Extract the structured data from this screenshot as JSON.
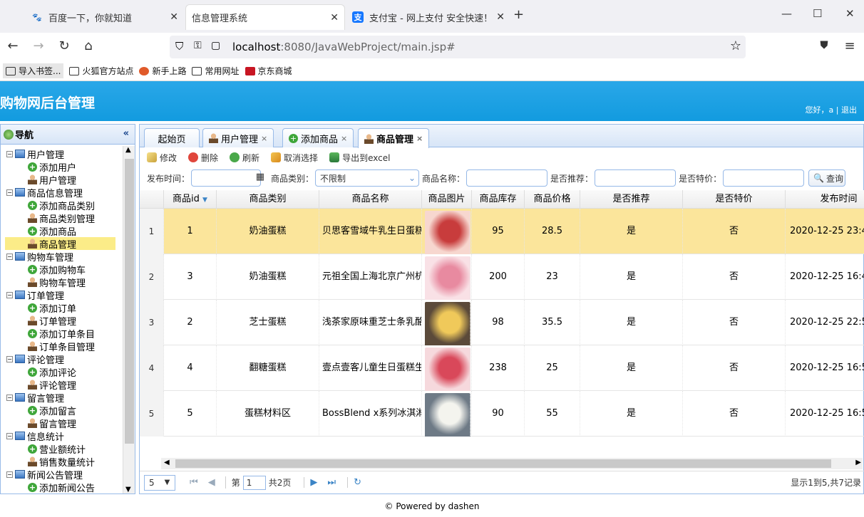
{
  "browser": {
    "tabs": [
      {
        "label": "百度一下，你就知道"
      },
      {
        "label": "信息管理系统"
      },
      {
        "label": "支付宝 - 网上支付 安全快速！"
      }
    ],
    "url_host": "localhost",
    "url_rest": ":8080/JavaWebProject/main.jsp#",
    "bookmarks": [
      "导入书签...",
      "火狐官方站点",
      "新手上路",
      "常用网址",
      "京东商城"
    ]
  },
  "header": {
    "title": "购物网后台管理",
    "greeting": "您好，a",
    "separator": "|",
    "logout": "退出"
  },
  "sidebar": {
    "title": "导航",
    "collapse": "«",
    "items": [
      {
        "label": "用户管理",
        "type": "group"
      },
      {
        "label": "添加用户",
        "type": "add"
      },
      {
        "label": "用户管理",
        "type": "manage"
      },
      {
        "label": "商品信息管理",
        "type": "group"
      },
      {
        "label": "添加商品类别",
        "type": "add"
      },
      {
        "label": "商品类别管理",
        "type": "manage"
      },
      {
        "label": "添加商品",
        "type": "add"
      },
      {
        "label": "商品管理",
        "type": "manage"
      },
      {
        "label": "购物车管理",
        "type": "group"
      },
      {
        "label": "添加购物车",
        "type": "add"
      },
      {
        "label": "购物车管理",
        "type": "manage"
      },
      {
        "label": "订单管理",
        "type": "group"
      },
      {
        "label": "添加订单",
        "type": "add"
      },
      {
        "label": "订单管理",
        "type": "manage"
      },
      {
        "label": "添加订单条目",
        "type": "add"
      },
      {
        "label": "订单条目管理",
        "type": "manage"
      },
      {
        "label": "评论管理",
        "type": "group"
      },
      {
        "label": "添加评论",
        "type": "add"
      },
      {
        "label": "评论管理",
        "type": "manage"
      },
      {
        "label": "留言管理",
        "type": "group"
      },
      {
        "label": "添加留言",
        "type": "add"
      },
      {
        "label": "留言管理",
        "type": "manage"
      },
      {
        "label": "信息统计",
        "type": "group"
      },
      {
        "label": "营业额统计",
        "type": "add"
      },
      {
        "label": "销售数量统计",
        "type": "manage"
      },
      {
        "label": "新闻公告管理",
        "type": "group"
      },
      {
        "label": "添加新闻公告",
        "type": "add"
      }
    ]
  },
  "main_tabs": [
    {
      "label": "起始页"
    },
    {
      "label": "用户管理"
    },
    {
      "label": "添加商品"
    },
    {
      "label": "商品管理"
    }
  ],
  "toolbar": {
    "edit": "修改",
    "delete": "删除",
    "refresh": "刷新",
    "cancel_select": "取消选择",
    "export": "导出到excel"
  },
  "filter": {
    "publish_time_label": "发布时间：",
    "category_label": "商品类别：",
    "category_value": "不限制",
    "name_label": "商品名称：",
    "recommend_label": "是否推荐：",
    "special_label": "是否特价：",
    "query": "查询"
  },
  "table": {
    "columns": [
      "商品id",
      "商品类别",
      "商品名称",
      "商品图片",
      "商品库存",
      "商品价格",
      "是否推荐",
      "是否特价",
      "发布时间"
    ],
    "rows": [
      {
        "rn": "1",
        "id": "1",
        "category": "奶油蛋糕",
        "name": "贝思客雪域牛乳生日蛋糕",
        "stock": "95",
        "price": "28.5",
        "recommend": "是",
        "special": "否",
        "time": "2020-12-25 23:4"
      },
      {
        "rn": "2",
        "id": "3",
        "category": "奶油蛋糕",
        "name": "元祖全国上海北京广州杭",
        "stock": "200",
        "price": "23",
        "recommend": "是",
        "special": "否",
        "time": "2020-12-25 16:4"
      },
      {
        "rn": "3",
        "id": "2",
        "category": "芝士蛋糕",
        "name": "浅茶家原味重芝士条乳酪",
        "stock": "98",
        "price": "35.5",
        "recommend": "是",
        "special": "否",
        "time": "2020-12-25 22:5"
      },
      {
        "rn": "4",
        "id": "4",
        "category": "翻糖蛋糕",
        "name": "壹点壹客儿童生日蛋糕生",
        "stock": "238",
        "price": "25",
        "recommend": "是",
        "special": "否",
        "time": "2020-12-25 16:5"
      },
      {
        "rn": "5",
        "id": "5",
        "category": "蛋糕材料区",
        "name": "BossBlend x系列冰淇淋",
        "stock": "90",
        "price": "55",
        "recommend": "是",
        "special": "否",
        "time": "2020-12-25 16:5"
      }
    ],
    "images": [
      {
        "c1": "#f7d7cf",
        "c2": "#c83c3c"
      },
      {
        "c1": "#f9e1e6",
        "c2": "#e88aa0"
      },
      {
        "c1": "#5b4a3a",
        "c2": "#f0c95a"
      },
      {
        "c1": "#f6d9dd",
        "c2": "#d9485a"
      },
      {
        "c1": "#6e7a86",
        "c2": "#f4f4ee"
      }
    ]
  },
  "pager": {
    "page_size": "5",
    "page_label": "第",
    "page_value": "1",
    "total_pages": "共2页",
    "summary": "显示1到5,共7记录"
  },
  "footer": "© Powered by dashen"
}
